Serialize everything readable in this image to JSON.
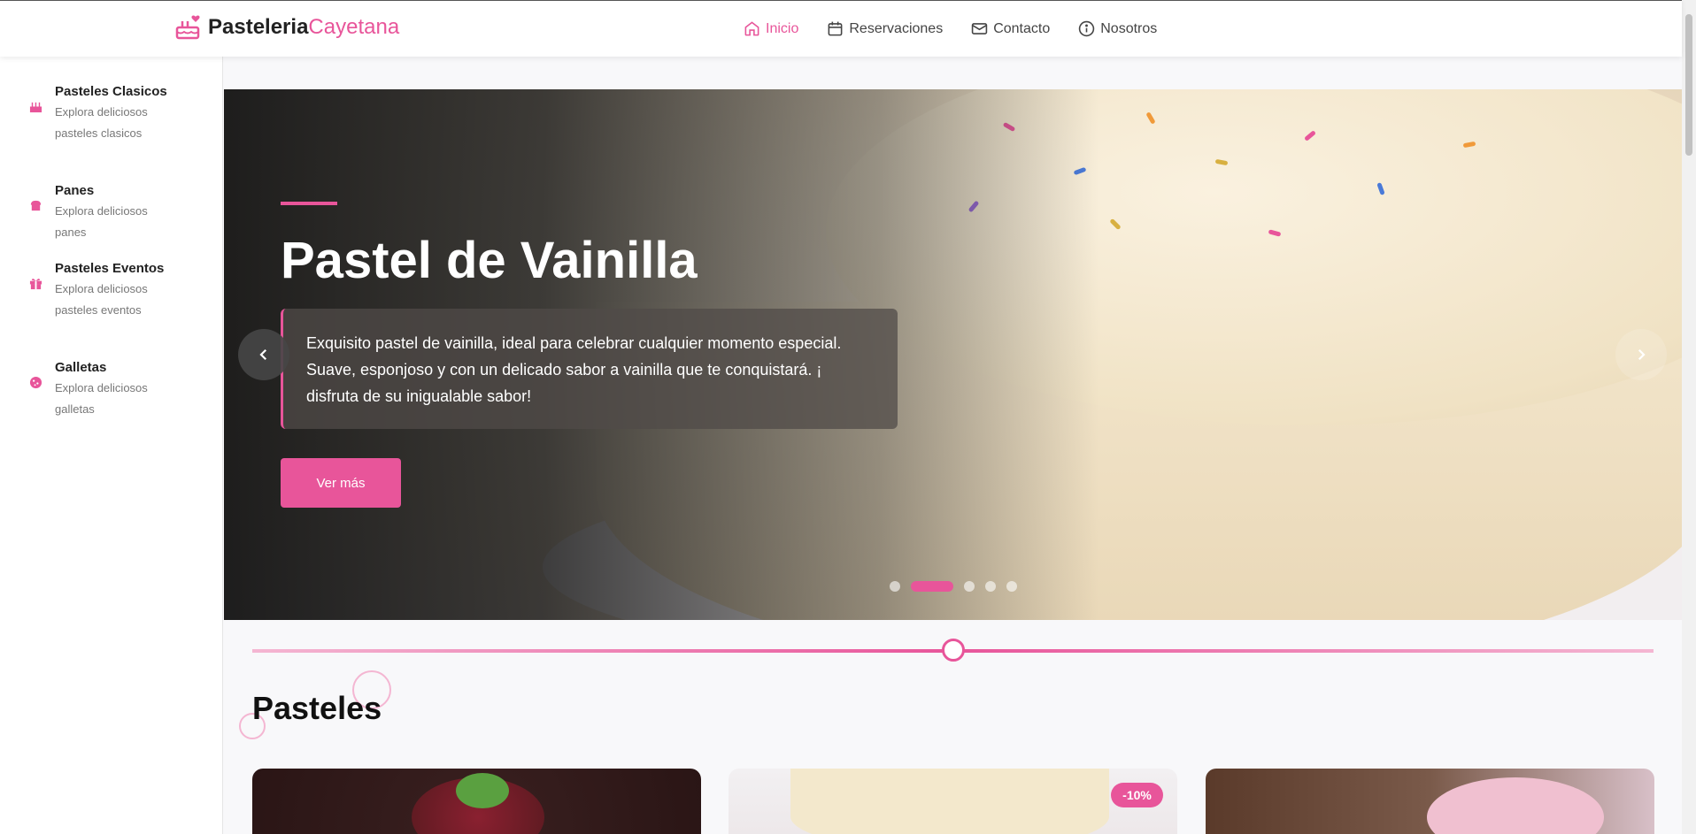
{
  "header": {
    "brand": "Pasteleria",
    "brand_accent": "Cayetana",
    "nav": [
      {
        "label": "Inicio",
        "icon": "home-icon",
        "active": true
      },
      {
        "label": "Reservaciones",
        "icon": "calendar-icon"
      },
      {
        "label": "Contacto",
        "icon": "mail-icon"
      },
      {
        "label": "Nosotros",
        "icon": "info-icon"
      }
    ]
  },
  "sidebar": {
    "items": [
      {
        "title": "Pasteles Clasicos",
        "desc": "Explora deliciosos pasteles clasicos",
        "icon": "cake-icon"
      },
      {
        "title": "Panes",
        "desc": "Explora deliciosos panes",
        "icon": "bread-icon"
      },
      {
        "title": "Pasteles Eventos",
        "desc": "Explora deliciosos pasteles eventos",
        "icon": "gift-icon"
      },
      {
        "title": "Galletas",
        "desc": "Explora deliciosos galletas",
        "icon": "cookie-icon"
      }
    ]
  },
  "hero": {
    "title": "Pastel de Vainilla",
    "description": "Exquisito pastel de vainilla, ideal para celebrar cualquier momento especial. Suave, esponjoso y con un delicado sabor a vainilla que te conquistará. ¡ disfruta de su inigualable sabor!",
    "button": "Ver más",
    "slide_count": 5,
    "active_slide": 2
  },
  "products": {
    "section_title": "Pasteles",
    "badge": "-10%"
  },
  "colors": {
    "accent": "#e8559a",
    "dark": "#222222"
  }
}
